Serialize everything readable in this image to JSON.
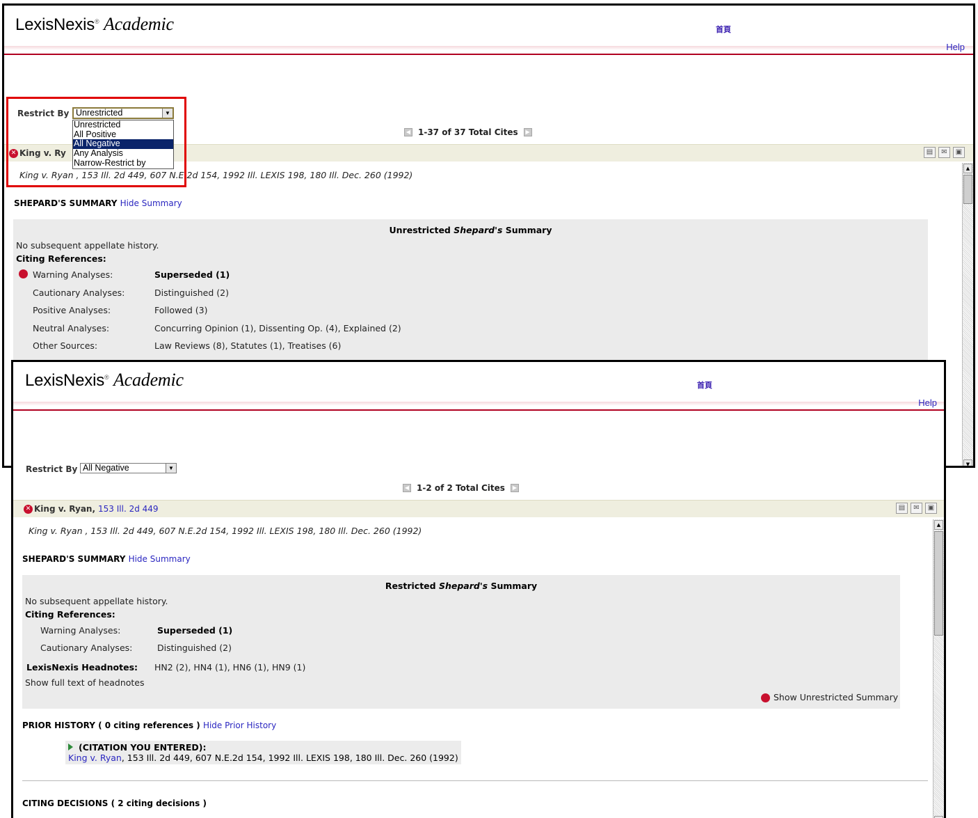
{
  "header": {
    "logo_main": "LexisNexis",
    "logo_reg": "®",
    "logo_sub": "Academic",
    "home_link": "首頁",
    "help_link": "Help"
  },
  "window1": {
    "restrict_label": "Restrict By",
    "restrict_value": "Unrestricted",
    "dropdown_options": [
      "Unrestricted",
      "All Positive",
      "All Negative",
      "Any Analysis",
      "Narrow-Restrict by"
    ],
    "dropdown_selected": "All Negative",
    "pager_text": "1-37 of 37 Total Cites",
    "case_title": "King v. Ry",
    "full_citation": "King v. Ryan , 153 Ill. 2d 449, 607 N.E.2d 154, 1992 Ill. LEXIS 198, 180 Ill. Dec. 260 (1992)",
    "summary_head": "SHEPARD'S SUMMARY",
    "hide_summary": "Hide Summary",
    "summary_title_pre": "Unrestricted",
    "summary_title_italic": "Shepard's",
    "summary_title_post": "Summary",
    "no_history": "No subsequent appellate history.",
    "citing_refs": "Citing References:",
    "rows": [
      {
        "label": "Warning Analyses:",
        "value": "Superseded (1)",
        "bold": true
      },
      {
        "label": "Cautionary Analyses:",
        "value": "Distinguished (2)"
      },
      {
        "label": "Positive Analyses:",
        "value": "Followed (3)"
      },
      {
        "label": "Neutral Analyses:",
        "value": "Concurring Opinion (1), Dissenting Op. (4), Explained (2)"
      },
      {
        "label": "Other Sources:",
        "value": "Law Reviews (8), Statutes (1), Treatises (6)"
      }
    ]
  },
  "window2": {
    "restrict_label": "Restrict By",
    "restrict_value": "All Negative",
    "pager_text": "1-2 of 2 Total Cites",
    "case_title": "King v. Ryan,",
    "case_cite_link": "153 Ill. 2d 449",
    "full_citation": "King v. Ryan , 153 Ill. 2d 449, 607 N.E.2d 154, 1992 Ill. LEXIS 198, 180 Ill. Dec. 260 (1992)",
    "summary_head": "SHEPARD'S SUMMARY",
    "hide_summary": "Hide Summary",
    "summary_title_pre": "Restricted",
    "summary_title_italic": "Shepard's",
    "summary_title_post": "Summary",
    "no_history": "No subsequent appellate history.",
    "citing_refs": "Citing References:",
    "rows": [
      {
        "label": "Warning Analyses:",
        "value": "Superseded (1)",
        "bold": true
      },
      {
        "label": "Cautionary Analyses:",
        "value": "Distinguished (2)"
      }
    ],
    "headnotes_label": "LexisNexis Headnotes:",
    "headnotes_value": "HN2 (2), HN4 (1), HN6 (1), HN9 (1)",
    "show_headnotes": "Show full text of headnotes",
    "show_unrestricted": "Show Unrestricted Summary",
    "prior_history_head": "PRIOR HISTORY ( 0 citing references )",
    "hide_prior": "Hide Prior History",
    "citation_entered_label": "(CITATION YOU ENTERED):",
    "entered_case_link": "King v. Ryan",
    "entered_citation_rest": ", 153 Ill. 2d 449, 607 N.E.2d 154, 1992 Ill. LEXIS 198, 180 Ill. Dec. 260 (1992)",
    "citing_decisions_head": "CITING DECISIONS ( 2 citing decisions )"
  },
  "icons": {
    "remove": "x-circle-icon",
    "print": "print-icon",
    "email": "email-icon",
    "save": "save-icon",
    "prev": "prev-page-icon",
    "next": "next-page-icon"
  },
  "colors": {
    "link": "#2a26c0",
    "header_rule": "#b00020",
    "highlight": "#e00000",
    "dropdown_selected_bg": "#0a246a",
    "summary_bg": "#ebebeb",
    "title_bar_bg": "#efeedf"
  }
}
